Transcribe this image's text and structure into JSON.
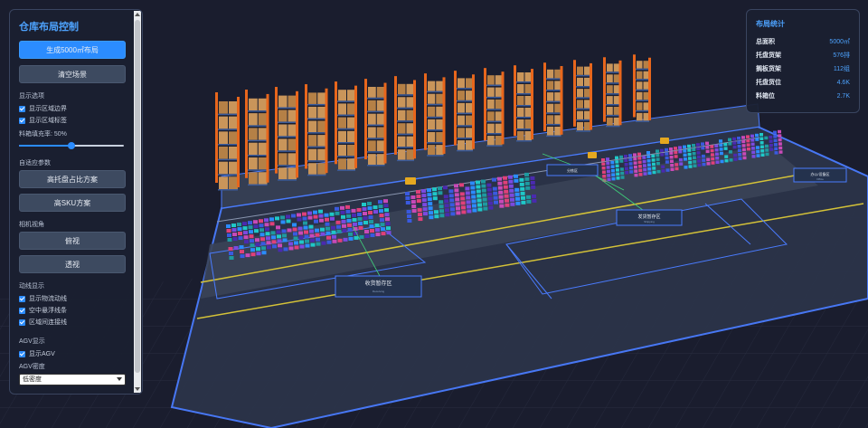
{
  "control": {
    "title": "仓库布局控制",
    "btn_generate": "生成5000㎡布局",
    "btn_clear": "清空场景",
    "display": {
      "section": "显示选项",
      "items": [
        "显示区域边界",
        "显示区域标签"
      ],
      "fill_label": "料箱填充率: 50%",
      "fill_rate": 0.5
    },
    "adaptive": {
      "section": "自适应参数",
      "btn_high_pallet": "高托盘占比方案",
      "btn_high_sku": "高SKU方案"
    },
    "camera": {
      "section": "相机视角",
      "btn_top": "俯视",
      "btn_persp": "透视"
    },
    "flow": {
      "section": "动线显示",
      "items": [
        "显示物流动线",
        "空中悬浮线条",
        "区域间连接线"
      ]
    },
    "agv": {
      "section": "AGV显示",
      "item": "显示AGV",
      "density_label": "AGV密度",
      "density_value": "低密度"
    }
  },
  "stats": {
    "title": "布局统计",
    "rows": [
      {
        "k": "总面积",
        "v": "5000㎡"
      },
      {
        "k": "托盘货架",
        "v": "576排"
      },
      {
        "k": "搁板货架",
        "v": "112组"
      },
      {
        "k": "托盘货位",
        "v": "4.6K"
      },
      {
        "k": "料箱位",
        "v": "2.7K"
      }
    ]
  },
  "zones": {
    "receiving": "收货暂存区",
    "shipping": "发货暂存区",
    "office": "办公/设备区",
    "sorting": "分拣区",
    "sub_receiving": "Receiving",
    "sub_shipping": "Shipping",
    "sub_office": "Office"
  },
  "colors": {
    "accent": "#2b8cff",
    "bg": "#1a1d2e",
    "upright": "#e8661c"
  }
}
